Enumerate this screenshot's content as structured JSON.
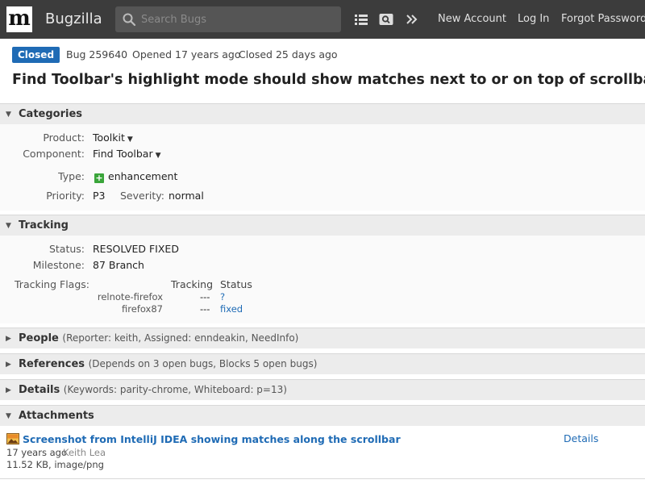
{
  "header": {
    "logo_letter": "m",
    "app_name": "Bugzilla",
    "search_placeholder": "Search Bugs",
    "icons": [
      "list-icon",
      "saved-search-icon",
      "more-chevron-icon"
    ],
    "links": {
      "new_account": "New Account",
      "log_in": "Log In",
      "forgot_password": "Forgot Password"
    }
  },
  "bug": {
    "status_badge": "Closed",
    "id": "Bug 259640",
    "opened": "Opened 17 years ago",
    "closed": "Closed 25 days ago",
    "summary": "Find Toolbar's highlight mode should show matches next to or on top of scrollbar"
  },
  "categories": {
    "title": "Categories",
    "product_label": "Product:",
    "product": "Toolkit",
    "component_label": "Component:",
    "component": "Find Toolbar",
    "type_label": "Type:",
    "type": "enhancement",
    "priority_label": "Priority:",
    "priority": "P3",
    "severity_label": "Severity:",
    "severity": "normal"
  },
  "tracking": {
    "title": "Tracking",
    "status_label": "Status:",
    "status": "RESOLVED FIXED",
    "milestone_label": "Milestone:",
    "milestone": "87 Branch",
    "flags_label": "Tracking Flags:",
    "col_tracking": "Tracking",
    "col_status": "Status",
    "flags": [
      {
        "name": "relnote-firefox",
        "tracking": "---",
        "status": "?"
      },
      {
        "name": "firefox87",
        "tracking": "---",
        "status": "fixed"
      }
    ]
  },
  "people": {
    "title": "People",
    "summary": "(Reporter: keith, Assigned: enndeakin, NeedInfo)"
  },
  "references": {
    "title": "References",
    "summary": "(Depends on 3 open bugs, Blocks 5 open bugs)"
  },
  "details": {
    "title": "Details",
    "summary": "(Keywords: parity-chrome, Whiteboard: p=13)"
  },
  "attachments": {
    "title": "Attachments",
    "items": [
      {
        "title": "Screenshot from IntelliJ IDEA showing matches along the scrollbar",
        "age": "17 years ago",
        "author": "Keith Lea",
        "size": "11.52 KB, image/png",
        "details_link": "Details"
      }
    ]
  },
  "colors": {
    "header_bg": "#3c3c3c",
    "accent": "#1f6bb5",
    "enhancement": "#3aa53a"
  }
}
